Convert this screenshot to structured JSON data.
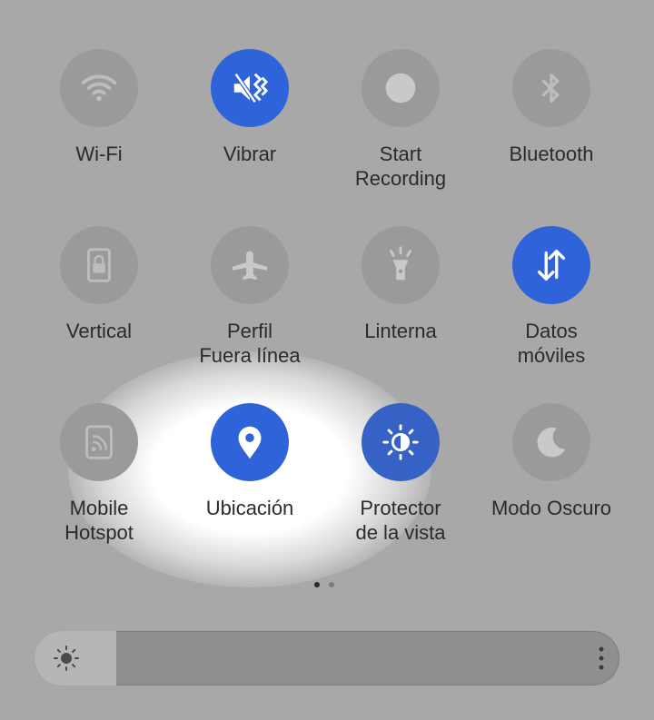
{
  "tiles": [
    {
      "label": "Wi-Fi",
      "icon": "wifi-icon",
      "on": false
    },
    {
      "label": "Vibrar",
      "icon": "vibrate-icon",
      "on": true
    },
    {
      "label": "Start\nRecording",
      "icon": "record-icon",
      "on": false
    },
    {
      "label": "Bluetooth",
      "icon": "bluetooth-icon",
      "on": false
    },
    {
      "label": "Vertical",
      "icon": "rotation-lock-icon",
      "on": false
    },
    {
      "label": "Perfil\nFuera línea",
      "icon": "airplane-icon",
      "on": false
    },
    {
      "label": "Linterna",
      "icon": "flashlight-icon",
      "on": false
    },
    {
      "label": "Datos\nmóviles",
      "icon": "mobile-data-icon",
      "on": true
    },
    {
      "label": "Mobile\nHotspot",
      "icon": "hotspot-icon",
      "on": false
    },
    {
      "label": "Ubicación",
      "icon": "location-icon",
      "on": true
    },
    {
      "label": "Protector\nde la vista",
      "icon": "eye-comfort-icon",
      "on": true
    },
    {
      "label": "Modo Oscuro",
      "icon": "dark-mode-icon",
      "on": false
    }
  ],
  "pager": {
    "pages": 2,
    "current": 1
  },
  "brightness": {
    "level": 0.14,
    "icon": "brightness-icon",
    "menu_icon": "more-vert-icon"
  },
  "colors": {
    "active": "#2f63d9",
    "inactive": "#9a9a9a",
    "icon_inactive": "#bdbdbd"
  }
}
